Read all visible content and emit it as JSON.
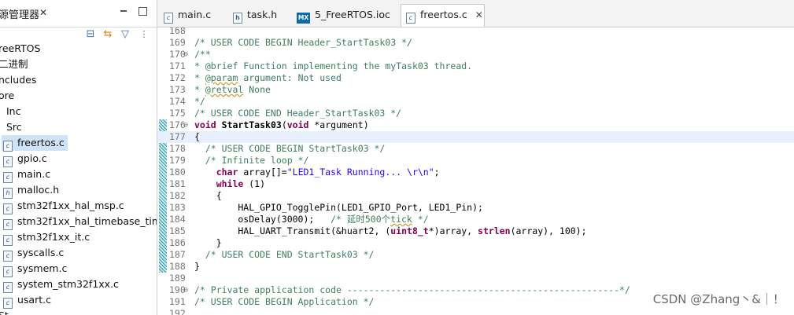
{
  "left_panel": {
    "title": "源管理器",
    "close": "✕",
    "toolbar_icons": [
      "collapse-all-icon",
      "link-with-editor-icon",
      "filter-icon",
      "view-menu-icon"
    ],
    "tree": [
      {
        "label": "reeRTOS",
        "type": "project",
        "indent": 0
      },
      {
        "label": "二进制",
        "type": "folder",
        "indent": 0
      },
      {
        "label": "ncludes",
        "type": "folder",
        "indent": 0
      },
      {
        "label": "ore",
        "type": "folder",
        "indent": 0
      },
      {
        "label": "Inc",
        "type": "folder",
        "indent": 1
      },
      {
        "label": "Src",
        "type": "folder",
        "indent": 1
      },
      {
        "label": "freertos.c",
        "type": "c",
        "indent": 2,
        "selected": true
      },
      {
        "label": "gpio.c",
        "type": "c",
        "indent": 2
      },
      {
        "label": "main.c",
        "type": "c",
        "indent": 2
      },
      {
        "label": "malloc.h",
        "type": "h",
        "indent": 2
      },
      {
        "label": "stm32f1xx_hal_msp.c",
        "type": "c",
        "indent": 2
      },
      {
        "label": "stm32f1xx_hal_timebase_tim.c",
        "type": "c",
        "indent": 2
      },
      {
        "label": "stm32f1xx_it.c",
        "type": "c",
        "indent": 2
      },
      {
        "label": "syscalls.c",
        "type": "c",
        "indent": 2
      },
      {
        "label": "sysmem.c",
        "type": "c",
        "indent": 2
      },
      {
        "label": "system_stm32f1xx.c",
        "type": "c",
        "indent": 2
      },
      {
        "label": "usart.c",
        "type": "c",
        "indent": 2
      },
      {
        "label": "St...",
        "type": "folder",
        "indent": 0
      }
    ]
  },
  "editor_tabs": [
    {
      "label": "main.c",
      "icon": "c",
      "active": false
    },
    {
      "label": "task.h",
      "icon": "h",
      "active": false
    },
    {
      "label": "5_FreeRTOS.ioc",
      "icon": "mx",
      "active": false
    },
    {
      "label": "freertos.c",
      "icon": "c",
      "active": true
    }
  ],
  "tab_close": "✕",
  "code_lines": [
    {
      "n": "168",
      "fold": "",
      "t": ""
    },
    {
      "n": "169",
      "fold": "",
      "t": "/* USER CODE BEGIN Header_StartTask03 */"
    },
    {
      "n": "170",
      "fold": "⊖",
      "t": "/**"
    },
    {
      "n": "171",
      "fold": "",
      "t": "* @brief Function implementing the myTask03 thread."
    },
    {
      "n": "172",
      "fold": "",
      "t": "* @param argument: Not used"
    },
    {
      "n": "173",
      "fold": "",
      "t": "* @retval None"
    },
    {
      "n": "174",
      "fold": "",
      "t": "*/"
    },
    {
      "n": "175",
      "fold": "",
      "t": "/* USER CODE END Header_StartTask03 */"
    },
    {
      "n": "176",
      "fold": "⊖",
      "t": "void StartTask03(void *argument)"
    },
    {
      "n": "177",
      "fold": "",
      "t": "{"
    },
    {
      "n": "178",
      "fold": "",
      "t": "  /* USER CODE BEGIN StartTask03 */"
    },
    {
      "n": "179",
      "fold": "",
      "t": "  /* Infinite loop */"
    },
    {
      "n": "180",
      "fold": "",
      "t": "    char array[]=\"LED1_Task Running... \\r\\n\";"
    },
    {
      "n": "181",
      "fold": "",
      "t": "    while (1)"
    },
    {
      "n": "182",
      "fold": "",
      "t": "    {"
    },
    {
      "n": "183",
      "fold": "",
      "t": "        HAL_GPIO_TogglePin(LED1_GPIO_Port, LED1_Pin);"
    },
    {
      "n": "184",
      "fold": "",
      "t": "        osDelay(3000);   /* 延时500个tick */"
    },
    {
      "n": "185",
      "fold": "",
      "t": "        HAL_UART_Transmit(&huart2, (uint8_t*)array, strlen(array), 100);"
    },
    {
      "n": "186",
      "fold": "",
      "t": "    }"
    },
    {
      "n": "187",
      "fold": "",
      "t": "  /* USER CODE END StartTask03 */"
    },
    {
      "n": "188",
      "fold": "",
      "t": "}"
    },
    {
      "n": "189",
      "fold": "",
      "t": ""
    },
    {
      "n": "190",
      "fold": "⊖",
      "t": "/* Private application code --------------------------------------------------*/"
    },
    {
      "n": "191",
      "fold": "",
      "t": "/* USER CODE BEGIN Application */"
    },
    {
      "n": "192",
      "fold": "",
      "t": ""
    }
  ],
  "watermark": "CSDN @Zhang丶&｜！"
}
